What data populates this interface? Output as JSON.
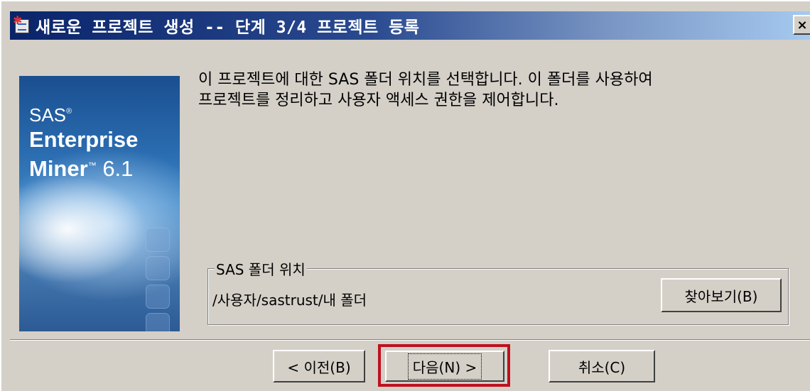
{
  "window": {
    "title": "새로운 프로젝트 생성 -- 단계 3/4 프로젝트 등록",
    "close_label": "×"
  },
  "banner": {
    "brand": "SAS",
    "brand_mark": "®",
    "line1": "Enterprise",
    "line2": "Miner",
    "tm": "™",
    "version": "6.1"
  },
  "content": {
    "description_line1": "이 프로젝트에 대한 SAS 폴더 위치를 선택합니다. 이 폴더를 사용하여",
    "description_line2": "프로젝트를 정리하고 사용자 액세스 권한을 제어합니다."
  },
  "folder_group": {
    "label": "SAS 폴더 위치",
    "path": "/사용자/sastrust/내 폴더",
    "browse_label": "찾아보기(B)"
  },
  "buttons": {
    "back_label": "< 이전(B)",
    "next_label": "다음(N) >",
    "cancel_label": "취소(C)"
  },
  "colors": {
    "highlight": "#c0101e",
    "titlebar_start": "#0a246a",
    "titlebar_end": "#a6caf0",
    "dialog_bg": "#d4d0c8"
  }
}
